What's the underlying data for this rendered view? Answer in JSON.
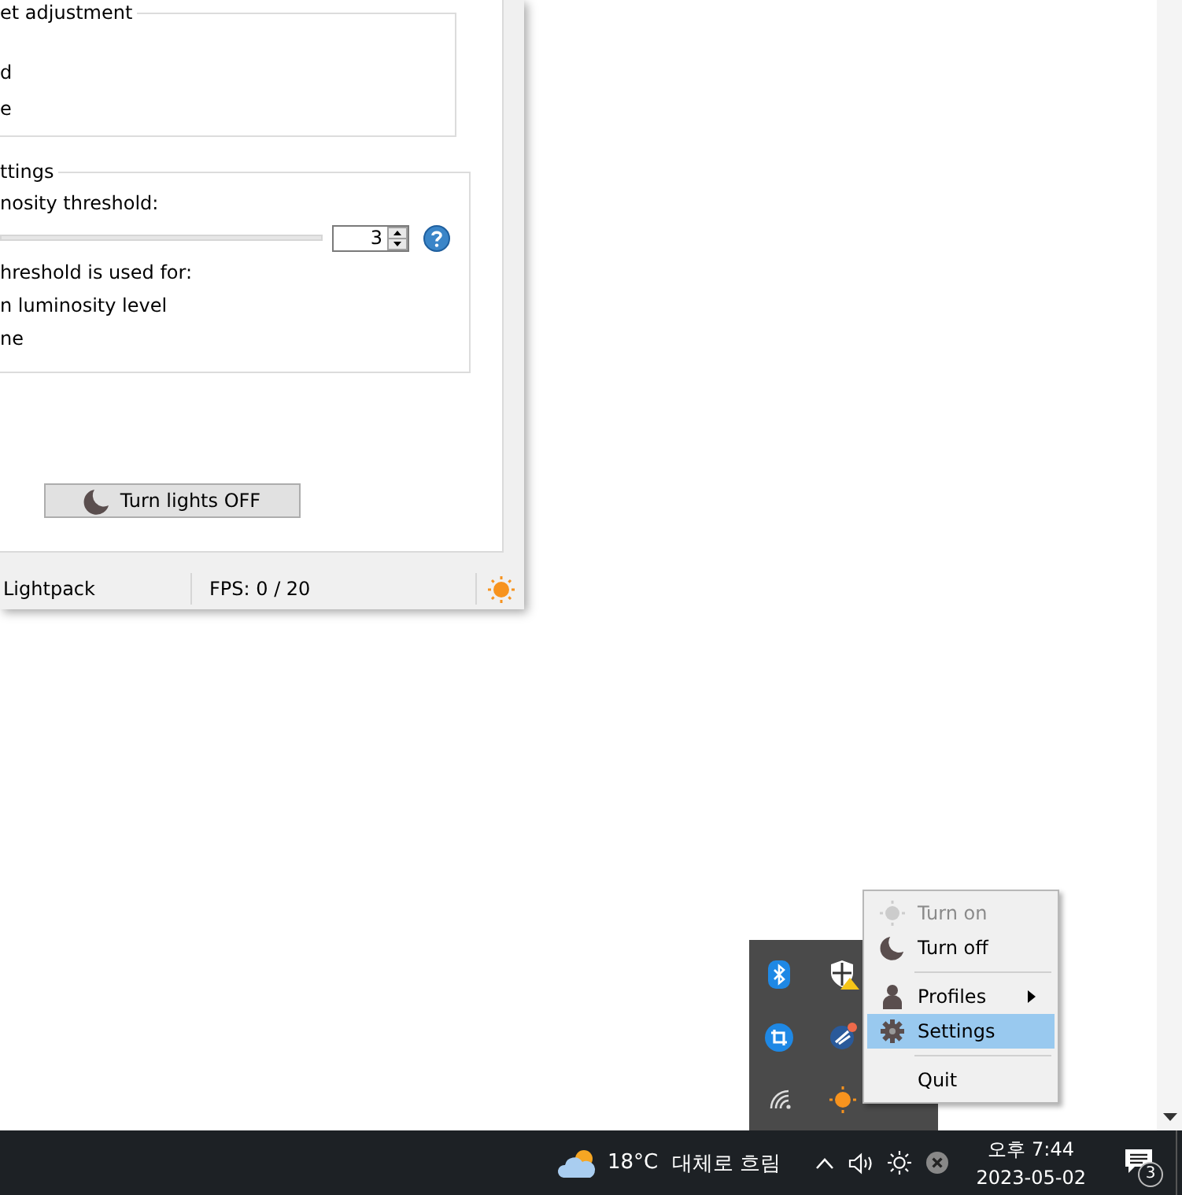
{
  "window": {
    "groups": [
      {
        "title": "et adjustment",
        "lines": [
          "d",
          "e"
        ]
      },
      {
        "title": "ttings",
        "label": "nosity threshold:",
        "spinbox": {
          "value": "3"
        },
        "lines": [
          "hreshold is used for:",
          "n luminosity level",
          "ne"
        ]
      }
    ],
    "button": {
      "label": "Turn lights OFF"
    },
    "status_bar": [
      "Lightpack",
      "FPS: 0 / 20"
    ]
  },
  "context_menu": {
    "items": [
      {
        "kind": "item",
        "label": "Turn on",
        "disabled": true,
        "selected": false,
        "submenu": false
      },
      {
        "kind": "item",
        "label": "Turn off",
        "disabled": false,
        "selected": false,
        "submenu": false
      },
      {
        "kind": "separator"
      },
      {
        "kind": "item",
        "label": "Profiles",
        "disabled": false,
        "selected": false,
        "submenu": true
      },
      {
        "kind": "item",
        "label": "Settings",
        "disabled": false,
        "selected": true,
        "submenu": false
      },
      {
        "kind": "separator"
      },
      {
        "kind": "item",
        "label": "Quit",
        "disabled": false,
        "selected": false,
        "submenu": false
      }
    ]
  },
  "taskbar": {
    "temperature": "18°C",
    "weather": "대체로 흐림",
    "time": "오후 7:44",
    "date": "2023-05-02",
    "notification_count": "3"
  }
}
